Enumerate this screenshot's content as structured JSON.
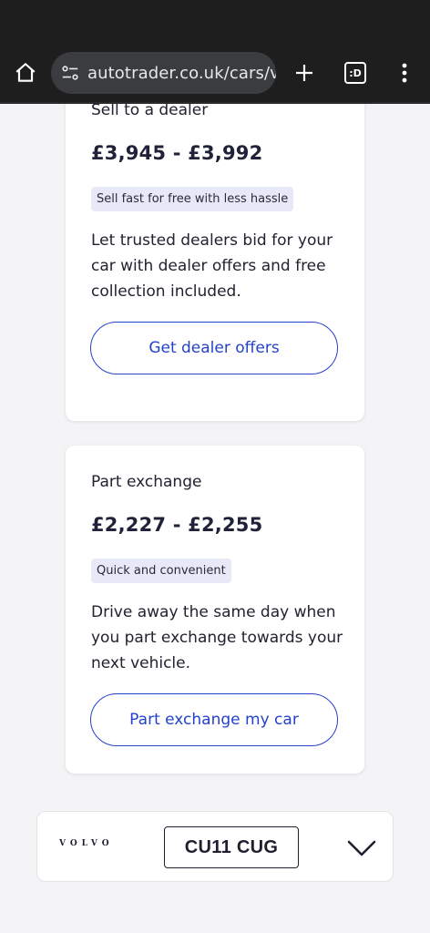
{
  "browser": {
    "url": "autotrader.co.uk/cars/va",
    "tabs_count": ":D"
  },
  "offers": [
    {
      "title": "Sell to a dealer",
      "price": "£3,945 - £3,992",
      "badge": "Sell fast for free with less hassle",
      "description": "Let trusted dealers bid for your car with dealer offers and free collection included.",
      "cta": "Get dealer offers"
    },
    {
      "title": "Part exchange",
      "price": "£2,227 - £2,255",
      "badge": "Quick and convenient",
      "description": "Drive away the same day when you part exchange towards your next vehicle.",
      "cta": "Part exchange my car"
    }
  ],
  "vehicle_bar": {
    "brand": "VOLVO",
    "registration": "CU11 CUG"
  },
  "colors": {
    "accent": "#2442c9",
    "badge_bg": "#e8e9f7",
    "browser_bg": "#1e1e1e",
    "page_bg": "#f4f4f6"
  }
}
